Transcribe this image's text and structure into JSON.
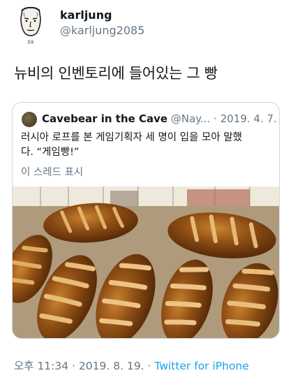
{
  "tweet": {
    "display_name": "karljung",
    "handle": "@karljung2085",
    "avatar_caption": "칼융",
    "text": "뉴비의 인벤토리에 들어있는 그 빵"
  },
  "quoted_tweet": {
    "display_name": "Cavebear in the Cave",
    "handle_truncated": "@Nay...",
    "separator": "·",
    "date": "2019. 4. 7.",
    "text_line1": "러시아 로프를 본 게임기획자 세 명이 입을 모아 말했",
    "text_line2": "다. “게임빵!”",
    "show_thread": "이 스레드 표시",
    "photo": "loaves-of-bread-on-tray"
  },
  "footer": {
    "time": "오후 11:34",
    "date": "2019. 8. 19.",
    "separator": "·",
    "source": "Twitter for iPhone"
  },
  "colors": {
    "text": "#14171a",
    "secondary": "#657786",
    "link": "#1da1f2",
    "border": "#ccd6dd"
  }
}
